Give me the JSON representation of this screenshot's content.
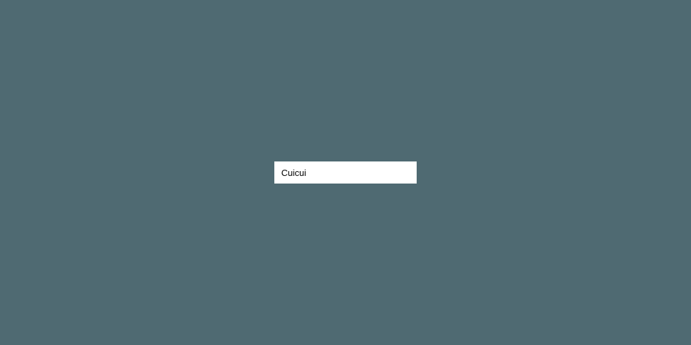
{
  "input": {
    "value": "Cuicui"
  }
}
